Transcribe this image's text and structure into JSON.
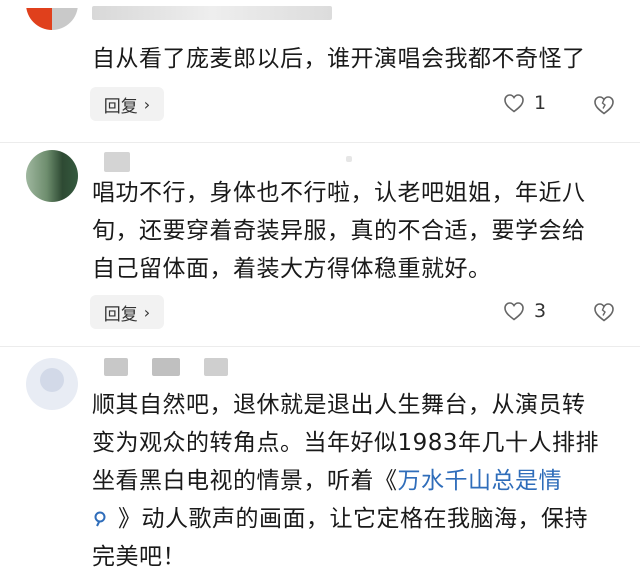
{
  "comments": [
    {
      "text": "自从看了庞麦郎以后，谁开演唱会我都不奇怪了",
      "reply_label": "回复",
      "like_count": "1"
    },
    {
      "text": "唱功不行，身体也不行啦，认老吧姐姐，年近八\n旬，还要穿着奇装异服，真的不合适，要学会给\n自己留体面，着装大方得体稳重就好。",
      "reply_label": "回复",
      "like_count": "3"
    },
    {
      "text_before": "顺其自然吧，退休就是退出人生舞台，从演员转\n变为观众的转角点。当年好似1983年几十人排排\n坐看黑白电视的情景，听着《",
      "song_link": "万水千山总是情",
      "text_after": "》动人歌声的画面，让它定格在我脑海，保持\n完美吧！"
    }
  ],
  "colors": {
    "link": "#2f6dba",
    "reply_bg": "#f2f2f2",
    "icon": "#666666"
  },
  "icons": {
    "chevron": "›",
    "like": "heart-outline-icon",
    "dislike": "broken-heart-icon",
    "search": "search-icon"
  }
}
